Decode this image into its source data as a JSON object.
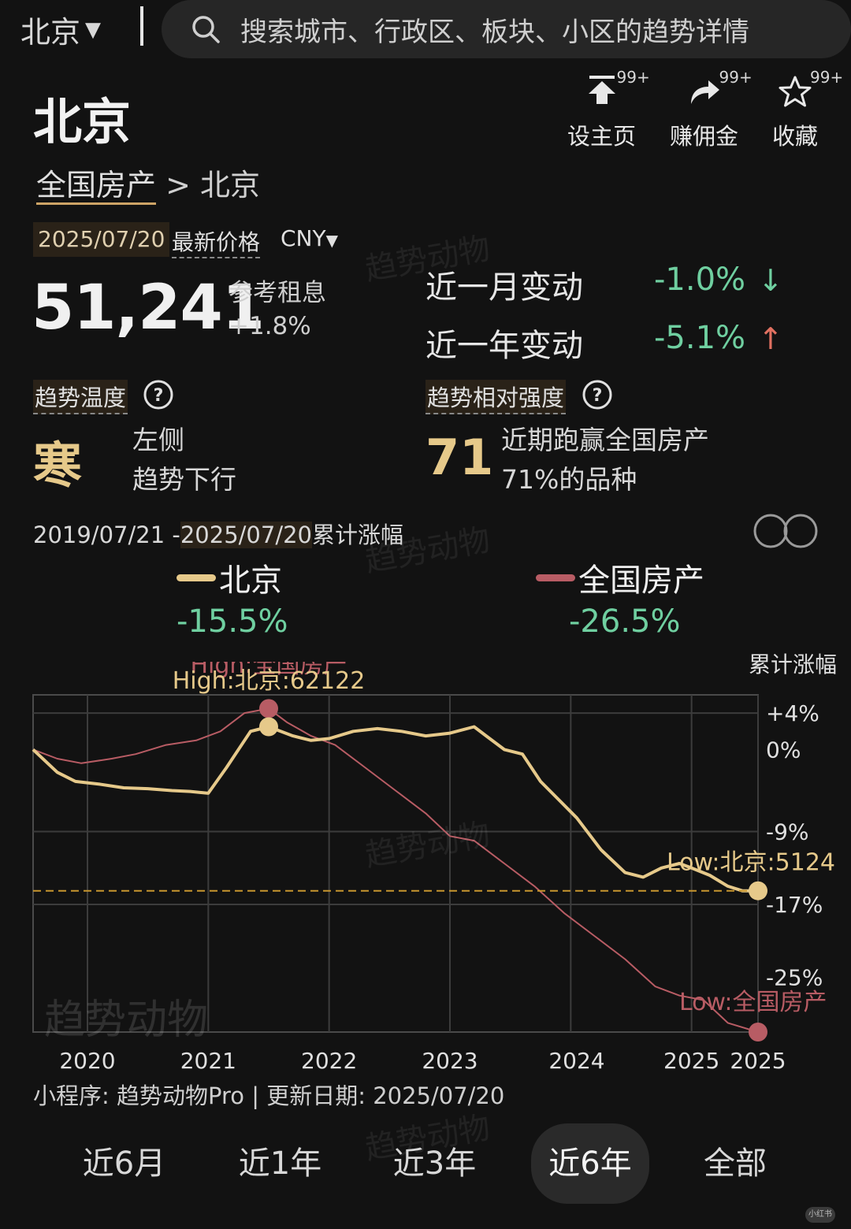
{
  "topbar": {
    "city": "北京",
    "search_placeholder": "搜索城市、行政区、板块、小区的趋势详情"
  },
  "title": "北京",
  "actions": [
    {
      "label": "设主页",
      "badge": "99+"
    },
    {
      "label": "赚佣金",
      "badge": "99+"
    },
    {
      "label": "收藏",
      "badge": "99+"
    }
  ],
  "breadcrumb": {
    "root": "全国房产",
    "sep": ">",
    "current": "北京"
  },
  "price": {
    "date": "2025/07/20",
    "label": "最新价格",
    "currency": "CNY",
    "value": "51,241",
    "rent_label": "参考租息",
    "rent_value": "+1.8%"
  },
  "changes": {
    "month_label": "近一月变动",
    "month_value": "-1.0%",
    "month_arrow": "↓",
    "year_label": "近一年变动",
    "year_value": "-5.1%",
    "year_arrow": "↑"
  },
  "colors": {
    "beijing": "#e6c98a",
    "national": "#b85c64",
    "negative": "#6fcfa0",
    "arrow_up": "#e07060"
  },
  "temperature": {
    "title": "趋势温度",
    "value": "寒",
    "desc1": "左侧",
    "desc2": "趋势下行"
  },
  "relative_strength": {
    "title": "趋势相对强度",
    "value": "71",
    "desc1": "近期跑赢全国房产",
    "desc2": "71%的品种"
  },
  "range": {
    "start": "2019/07/21 -",
    "end": "2025/07/20",
    "suffix": "累计涨幅"
  },
  "legend": [
    {
      "name": "北京",
      "value": "-15.5%"
    },
    {
      "name": "全国房产",
      "value": "-26.5%"
    }
  ],
  "chart_data": {
    "type": "line",
    "ylabel": "累计涨幅",
    "y_ticks": [
      "+4%",
      "0%",
      "-9%",
      "-17%",
      "-25%"
    ],
    "x_ticks": [
      "2020",
      "2021",
      "2022",
      "2023",
      "2024",
      "2025",
      "2025"
    ],
    "annotations": {
      "national_high": "High:全国房产",
      "beijing_high": "High:北京:62122",
      "beijing_low": "Low:北京:5124",
      "national_low": "Low:全国房产"
    },
    "series": [
      {
        "name": "北京",
        "x": [
          2019.55,
          2019.75,
          2019.9,
          2020.1,
          2020.3,
          2020.5,
          2020.7,
          2020.85,
          2021.0,
          2021.15,
          2021.35,
          2021.5,
          2021.7,
          2021.85,
          2022.0,
          2022.2,
          2022.4,
          2022.6,
          2022.8,
          2023.0,
          2023.2,
          2023.3,
          2023.45,
          2023.6,
          2023.75,
          2023.9,
          2024.05,
          2024.25,
          2024.45,
          2024.6,
          2024.75,
          2024.9,
          2025.0,
          2025.15,
          2025.3,
          2025.42,
          2025.55
        ],
        "y": [
          0,
          -2.5,
          -3.5,
          -3.8,
          -4.2,
          -4.3,
          -4.5,
          -4.6,
          -4.8,
          -2.0,
          2.0,
          2.5,
          1.5,
          1.0,
          1.2,
          2.0,
          2.3,
          2.0,
          1.5,
          1.8,
          2.5,
          1.5,
          0,
          -0.5,
          -3.5,
          -5.5,
          -7.5,
          -11.0,
          -13.5,
          -14.0,
          -13.0,
          -12.5,
          -13.0,
          -13.8,
          -15.0,
          -15.5,
          -15.5
        ]
      },
      {
        "name": "全国房产",
        "x": [
          2019.55,
          2019.75,
          2019.95,
          2020.2,
          2020.4,
          2020.65,
          2020.9,
          2021.1,
          2021.3,
          2021.5,
          2021.65,
          2021.85,
          2022.05,
          2022.3,
          2022.55,
          2022.8,
          2023.0,
          2023.2,
          2023.45,
          2023.7,
          2023.95,
          2024.2,
          2024.45,
          2024.7,
          2024.9,
          2025.1,
          2025.3,
          2025.55
        ],
        "y": [
          0,
          -1.0,
          -1.5,
          -1.0,
          -0.5,
          0.5,
          1.0,
          2.0,
          4.0,
          4.5,
          3.0,
          1.5,
          0.5,
          -2.0,
          -4.5,
          -7.0,
          -9.5,
          -10.0,
          -12.5,
          -15.0,
          -18.0,
          -20.5,
          -23.0,
          -26.0,
          -27.0,
          -27.5,
          -30.0,
          -31.0
        ]
      }
    ]
  },
  "footer": "小程序: 趋势动物Pro | 更新日期: 2025/07/20",
  "tabs": [
    {
      "label": "近6月"
    },
    {
      "label": "近1年"
    },
    {
      "label": "近3年"
    },
    {
      "label": "近6年"
    },
    {
      "label": "全部"
    }
  ],
  "watermark": "趋势动物",
  "corner_mark": "小红书"
}
